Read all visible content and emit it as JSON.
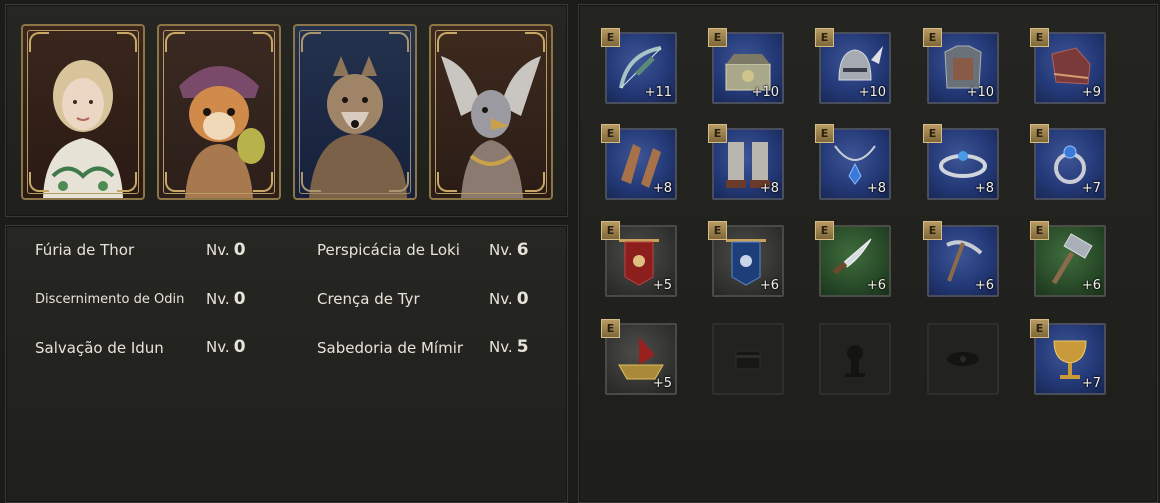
{
  "cards": [
    {
      "name": "portrait-card-girl"
    },
    {
      "name": "portrait-card-squirrel"
    },
    {
      "name": "portrait-card-wolf"
    },
    {
      "name": "portrait-card-griffin"
    }
  ],
  "stats": [
    {
      "label": "Fúria de Thor",
      "lvl_prefix": "Nv.",
      "level": "0"
    },
    {
      "label": "Perspicácia de Loki",
      "lvl_prefix": "Nv.",
      "level": "6"
    },
    {
      "label": "Discernimento de Odin",
      "lvl_prefix": "Nv.",
      "level": "0"
    },
    {
      "label": "Crença de Tyr",
      "lvl_prefix": "Nv.",
      "level": "0"
    },
    {
      "label": "Salvação de Idun",
      "lvl_prefix": "Nv.",
      "level": "0"
    },
    {
      "label": "Sabedoria de Mímir",
      "lvl_prefix": "Nv.",
      "level": "5"
    }
  ],
  "equipment": [
    {
      "icon": "bow-icon",
      "grade": "E",
      "plus": "+11",
      "color": "blue"
    },
    {
      "icon": "chest-icon",
      "grade": "E",
      "plus": "+10",
      "color": "blue"
    },
    {
      "icon": "helmet-icon",
      "grade": "E",
      "plus": "+10",
      "color": "blue"
    },
    {
      "icon": "armor-icon",
      "grade": "E",
      "plus": "+10",
      "color": "blue"
    },
    {
      "icon": "boots-icon",
      "grade": "E",
      "plus": "+9",
      "color": "blue"
    },
    {
      "icon": "bracers-icon",
      "grade": "E",
      "plus": "+8",
      "color": "blue"
    },
    {
      "icon": "greaves-icon",
      "grade": "E",
      "plus": "+8",
      "color": "blue"
    },
    {
      "icon": "necklace-icon",
      "grade": "E",
      "plus": "+8",
      "color": "blue"
    },
    {
      "icon": "bracelet-icon",
      "grade": "E",
      "plus": "+8",
      "color": "blue"
    },
    {
      "icon": "ring-icon",
      "grade": "E",
      "plus": "+7",
      "color": "blue"
    },
    {
      "icon": "red-banner-icon",
      "grade": "E",
      "plus": "+5",
      "color": "gray"
    },
    {
      "icon": "blue-banner-icon",
      "grade": "E",
      "plus": "+6",
      "color": "gray"
    },
    {
      "icon": "knife-icon",
      "grade": "E",
      "plus": "+6",
      "color": "green"
    },
    {
      "icon": "pickaxe-icon",
      "grade": "E",
      "plus": "+6",
      "color": "blue"
    },
    {
      "icon": "hammer-icon",
      "grade": "E",
      "plus": "+6",
      "color": "green"
    },
    {
      "icon": "ship-icon",
      "grade": "E",
      "plus": "+5",
      "color": "gray"
    },
    {
      "icon": "empty-chest-slot-icon",
      "grade": "",
      "plus": "",
      "color": "empty"
    },
    {
      "icon": "empty-totem-slot-icon",
      "grade": "",
      "plus": "",
      "color": "empty"
    },
    {
      "icon": "empty-eye-slot-icon",
      "grade": "",
      "plus": "",
      "color": "empty"
    },
    {
      "icon": "goblet-icon",
      "grade": "E",
      "plus": "+7",
      "color": "blue"
    }
  ]
}
